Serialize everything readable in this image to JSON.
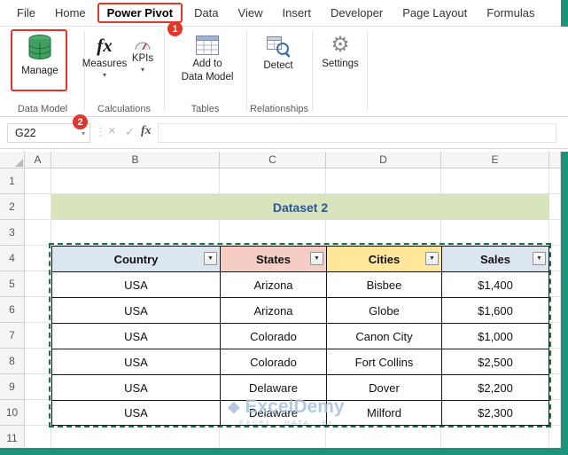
{
  "window": {
    "tabs": [
      "File",
      "Home",
      "Power Pivot",
      "Data",
      "View",
      "Insert",
      "Developer",
      "Page Layout",
      "Formulas"
    ],
    "active_tab": "Power Pivot"
  },
  "annotations": {
    "step1": "1",
    "step2": "2"
  },
  "ribbon": {
    "manage": {
      "label": "Manage"
    },
    "measures": {
      "label": "Measures"
    },
    "kpis": {
      "label": "KPIs"
    },
    "add_to_data_model": {
      "line1": "Add to",
      "line2": "Data Model"
    },
    "detect": {
      "label": "Detect"
    },
    "settings": {
      "label": "Settings"
    },
    "groups": {
      "data_model": "Data Model",
      "calculations": "Calculations",
      "tables": "Tables",
      "relationships": "Relationships"
    }
  },
  "formula_bar": {
    "name_box": "G22",
    "formula": ""
  },
  "sheet": {
    "col_headers": [
      "A",
      "B",
      "C",
      "D",
      "E"
    ],
    "row_headers": [
      "1",
      "2",
      "3",
      "4",
      "5",
      "6",
      "7",
      "8",
      "9",
      "10",
      "11"
    ],
    "title_banner": "Dataset 2",
    "table": {
      "headers": [
        "Country",
        "States",
        "Cities",
        "Sales"
      ],
      "header_colors": [
        "#dce6f1",
        "#f6cdc5",
        "#ffe699",
        "#dce6f1"
      ],
      "rows": [
        [
          "USA",
          "Arizona",
          "Bisbee",
          "$1,400"
        ],
        [
          "USA",
          "Arizona",
          "Globe",
          "$1,600"
        ],
        [
          "USA",
          "Colorado",
          "Canon City",
          "$1,000"
        ],
        [
          "USA",
          "Colorado",
          "Fort Collins",
          "$2,500"
        ],
        [
          "USA",
          "Delaware",
          "Dover",
          "$2,200"
        ],
        [
          "USA",
          "Delaware",
          "Milford",
          "$2,300"
        ]
      ]
    },
    "watermark": {
      "name": "ExcelDemy",
      "tagline": "EXCEL · DATA · BI"
    }
  },
  "icons": {
    "chevron_down": "▾",
    "filter_arrow": "▼",
    "dots": "⋮",
    "cancel": "×",
    "check": "✓",
    "fx": "fx",
    "gear": "⚙",
    "diamond": "◆"
  },
  "colors": {
    "annotation_red": "#e0362b",
    "marching_ants_green": "#1e7145",
    "banner_bg": "#d7e4bc",
    "banner_text": "#2f5597",
    "window_green": "#1d937c",
    "watermark_blue": "#a6c1dc"
  }
}
